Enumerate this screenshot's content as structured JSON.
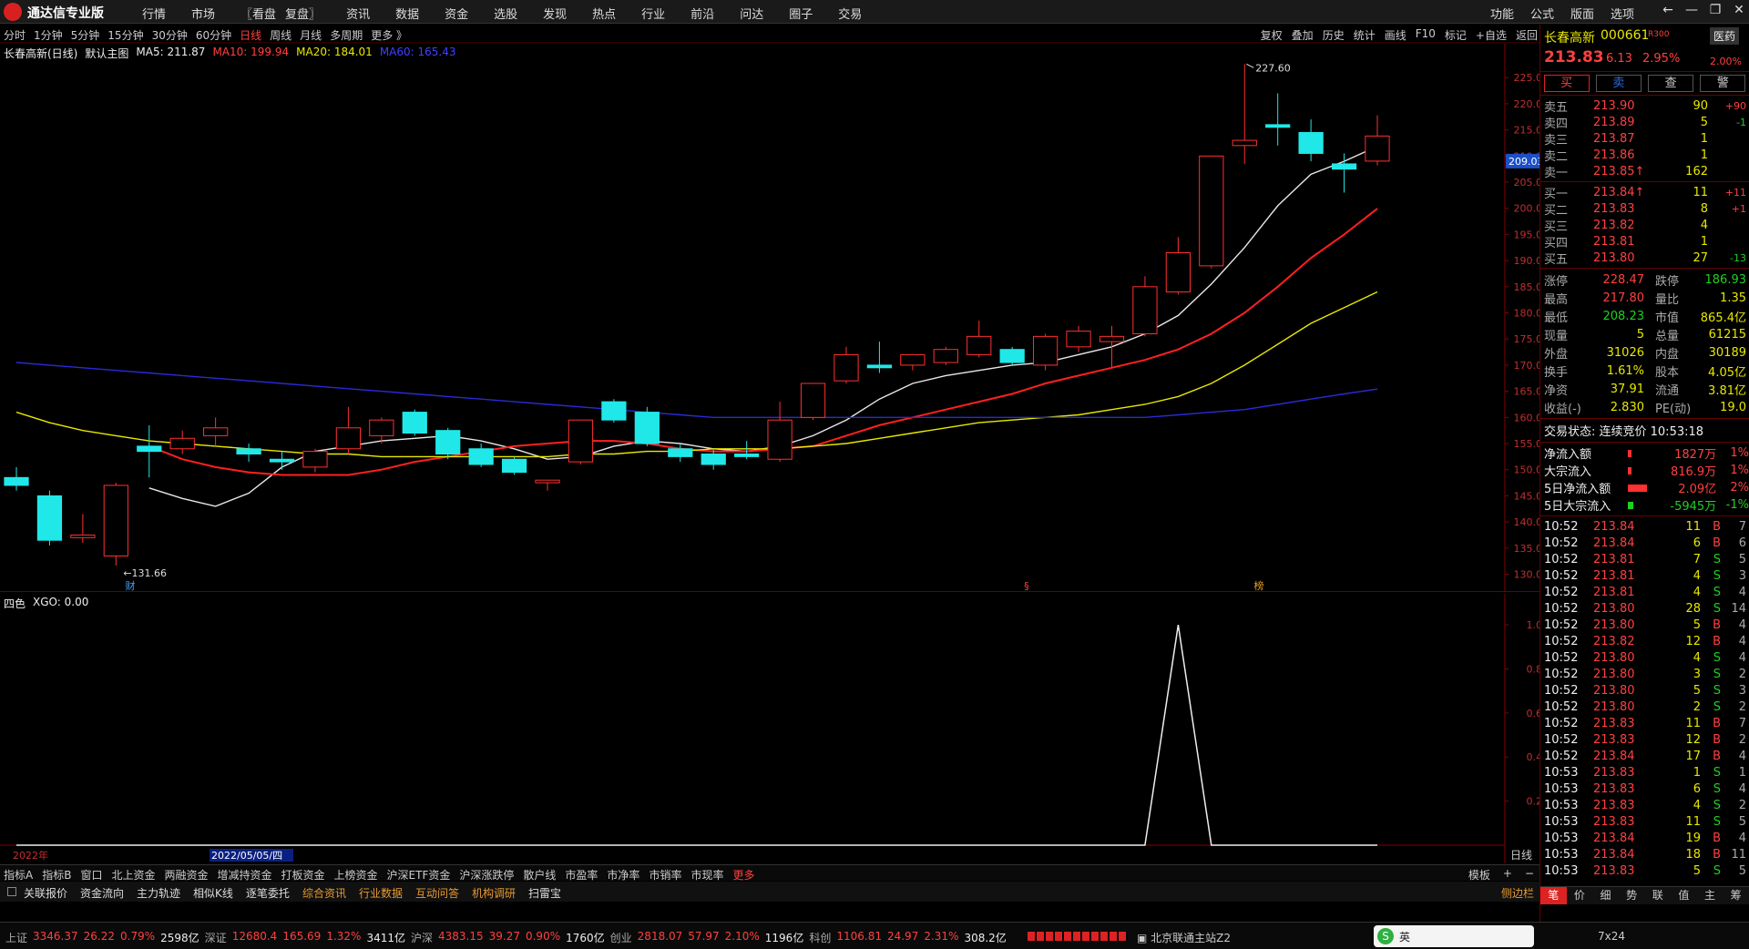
{
  "app": {
    "title": "通达信专业版",
    "menu": [
      "行情",
      "市场",
      "〖看盘",
      "复盘〗",
      "资讯",
      "数据",
      "资金",
      "选股",
      "发现",
      "热点",
      "行业",
      "前沿",
      "问达",
      "圈子",
      "交易"
    ],
    "right_menu": [
      "功能",
      "公式",
      "版面",
      "选项"
    ]
  },
  "period_bar": {
    "items": [
      "分时",
      "1分钟",
      "5分钟",
      "15分钟",
      "30分钟",
      "60分钟",
      "日线",
      "周线",
      "月线",
      "多周期",
      "更多 》"
    ],
    "active": "日线",
    "tools": [
      "复权",
      "叠加",
      "历史",
      "统计",
      "画线",
      "F10",
      "标记",
      "+自选",
      "返回"
    ]
  },
  "legend": {
    "name": "长春高新(日线)",
    "template": "默认主图",
    "ma5": "MA5: 211.87",
    "ma10": "MA10: 199.94",
    "ma20": "MA20: 184.01",
    "ma60": "MA60: 165.43"
  },
  "indicator": {
    "name": "四色",
    "value": "XGO: 0.00"
  },
  "chart_data": [
    {
      "type": "candlestick",
      "title": "长春高新(日线)",
      "ylim": [
        128,
        228
      ],
      "y_ticks": [
        130,
        135,
        140,
        145,
        150,
        155,
        160,
        165,
        170,
        175,
        180,
        185,
        190,
        195,
        200,
        205,
        210,
        215,
        220,
        225
      ],
      "y_tick_labels": [
        "130.00",
        "135.00",
        "140.00",
        "145.00",
        "150.00",
        "155.00",
        "160.00",
        "165.00",
        "170.00",
        "175.00",
        "180.00",
        "185.00",
        "190.00",
        "195.00",
        "200.00",
        "205.00",
        "210.00",
        "215.00",
        "220.00",
        "225.00"
      ],
      "current_price_label": "209.03",
      "current_price": 209.03,
      "high_label": "227.60",
      "high_value": 227.6,
      "low_label": "←131.66",
      "low_value": 131.66,
      "x_labels": [
        "2022年",
        "2022/05/05/四"
      ],
      "markers": [
        "财",
        "§",
        "榜"
      ],
      "candles": [
        {
          "o": 148.5,
          "h": 150.5,
          "c": 147.0,
          "l": 146.0
        },
        {
          "o": 145.0,
          "h": 146.0,
          "c": 136.5,
          "l": 135.5
        },
        {
          "o": 137.0,
          "h": 141.5,
          "c": 137.5,
          "l": 136.0
        },
        {
          "o": 133.5,
          "h": 147.5,
          "c": 147.0,
          "l": 131.66
        },
        {
          "o": 154.5,
          "h": 158.5,
          "c": 153.5,
          "l": 148.5
        },
        {
          "o": 154.0,
          "h": 157.5,
          "c": 156.0,
          "l": 153.0
        },
        {
          "o": 156.5,
          "h": 160.0,
          "c": 158.0,
          "l": 154.5
        },
        {
          "o": 154.0,
          "h": 155.0,
          "c": 153.0,
          "l": 151.5
        },
        {
          "o": 152.0,
          "h": 153.5,
          "c": 151.5,
          "l": 150.0
        },
        {
          "o": 150.5,
          "h": 154.0,
          "c": 153.5,
          "l": 149.5
        },
        {
          "o": 154.0,
          "h": 162.0,
          "c": 158.0,
          "l": 153.0
        },
        {
          "o": 156.5,
          "h": 160.0,
          "c": 159.5,
          "l": 155.0
        },
        {
          "o": 161.0,
          "h": 161.5,
          "c": 157.0,
          "l": 156.5
        },
        {
          "o": 157.5,
          "h": 158.0,
          "c": 153.0,
          "l": 152.0
        },
        {
          "o": 154.0,
          "h": 155.0,
          "c": 151.0,
          "l": 150.5
        },
        {
          "o": 152.0,
          "h": 152.5,
          "c": 149.5,
          "l": 149.0
        },
        {
          "o": 147.5,
          "h": 148.0,
          "c": 148.0,
          "l": 146.0
        },
        {
          "o": 151.5,
          "h": 159.5,
          "c": 159.5,
          "l": 151.0
        },
        {
          "o": 163.0,
          "h": 163.5,
          "c": 159.5,
          "l": 159.0
        },
        {
          "o": 161.0,
          "h": 162.0,
          "c": 155.0,
          "l": 154.5
        },
        {
          "o": 154.0,
          "h": 155.0,
          "c": 152.5,
          "l": 151.5
        },
        {
          "o": 153.0,
          "h": 154.0,
          "c": 151.0,
          "l": 150.0
        },
        {
          "o": 153.0,
          "h": 155.5,
          "c": 152.5,
          "l": 152.0
        },
        {
          "o": 152.0,
          "h": 163.0,
          "c": 159.5,
          "l": 151.5
        },
        {
          "o": 160.0,
          "h": 166.5,
          "c": 166.5,
          "l": 159.5
        },
        {
          "o": 167.0,
          "h": 173.5,
          "c": 172.0,
          "l": 166.5
        },
        {
          "o": 170.0,
          "h": 174.5,
          "c": 169.5,
          "l": 168.5
        },
        {
          "o": 170.0,
          "h": 172.0,
          "c": 172.0,
          "l": 169.0
        },
        {
          "o": 170.5,
          "h": 173.5,
          "c": 173.0,
          "l": 170.0
        },
        {
          "o": 172.0,
          "h": 178.5,
          "c": 175.5,
          "l": 171.5
        },
        {
          "o": 173.0,
          "h": 173.5,
          "c": 170.5,
          "l": 170.0
        },
        {
          "o": 170.0,
          "h": 176.0,
          "c": 175.5,
          "l": 169.0
        },
        {
          "o": 173.5,
          "h": 177.5,
          "c": 176.5,
          "l": 172.5
        },
        {
          "o": 174.5,
          "h": 177.5,
          "c": 175.5,
          "l": 169.5
        },
        {
          "o": 176.0,
          "h": 187.0,
          "c": 185.0,
          "l": 175.5
        },
        {
          "o": 184.0,
          "h": 194.5,
          "c": 191.5,
          "l": 183.5
        },
        {
          "o": 189.0,
          "h": 210.0,
          "c": 210.0,
          "l": 188.5
        },
        {
          "o": 212.0,
          "h": 227.6,
          "c": 213.0,
          "l": 208.5
        },
        {
          "o": 216.0,
          "h": 222.0,
          "c": 215.5,
          "l": 212.0
        },
        {
          "o": 214.5,
          "h": 217.0,
          "c": 210.5,
          "l": 209.0
        },
        {
          "o": 208.5,
          "h": 210.5,
          "c": 207.5,
          "l": 203.0
        },
        {
          "o": 209.03,
          "h": 217.8,
          "c": 213.83,
          "l": 208.23
        }
      ],
      "ma_series": [
        {
          "name": "MA5",
          "color": "#e8e8e8",
          "values": [
            null,
            null,
            null,
            null,
            146.5,
            144.5,
            143.0,
            145.5,
            150.5,
            153.5,
            154.5,
            155.5,
            156.0,
            156.5,
            155.5,
            154.0,
            152.0,
            152.5,
            154.5,
            155.5,
            155.0,
            154.0,
            153.5,
            154.5,
            156.5,
            159.5,
            163.5,
            166.5,
            168.0,
            169.0,
            170.0,
            170.5,
            172.0,
            173.5,
            176.0,
            179.5,
            185.5,
            192.5,
            200.5,
            206.5,
            209.0,
            211.87
          ]
        },
        {
          "name": "MA10",
          "color": "#ff2020",
          "values": [
            null,
            null,
            null,
            null,
            154.5,
            152.0,
            150.5,
            149.5,
            149.0,
            149.0,
            149.0,
            150.0,
            151.5,
            152.5,
            153.5,
            154.5,
            155.0,
            155.5,
            155.5,
            155.0,
            154.0,
            153.5,
            153.5,
            154.0,
            154.5,
            156.5,
            158.5,
            160.0,
            161.5,
            163.0,
            164.5,
            166.5,
            168.0,
            169.5,
            171.0,
            173.0,
            176.0,
            180.0,
            185.0,
            190.5,
            195.0,
            199.94
          ]
        },
        {
          "name": "MA20",
          "color": "#e8e800",
          "values": [
            161.0,
            159.0,
            157.5,
            156.5,
            155.5,
            155.0,
            154.5,
            154.0,
            153.5,
            153.0,
            153.0,
            152.5,
            152.5,
            152.5,
            152.5,
            152.5,
            152.5,
            153.0,
            153.0,
            153.5,
            153.5,
            154.0,
            154.0,
            154.0,
            154.5,
            155.0,
            156.0,
            157.0,
            158.0,
            159.0,
            159.5,
            160.0,
            160.5,
            161.5,
            162.5,
            164.0,
            166.5,
            170.0,
            174.0,
            178.0,
            181.0,
            184.01
          ]
        },
        {
          "name": "MA60",
          "color": "#2a2ad8",
          "values": [
            170.5,
            170.0,
            169.5,
            169.0,
            168.5,
            168.0,
            167.5,
            167.0,
            166.5,
            166.0,
            165.5,
            165.0,
            164.5,
            164.0,
            163.5,
            163.0,
            162.5,
            162.0,
            161.5,
            161.0,
            160.5,
            160.0,
            160.0,
            160.0,
            160.0,
            160.0,
            160.0,
            160.0,
            160.0,
            160.0,
            160.0,
            160.0,
            160.0,
            160.0,
            160.0,
            160.5,
            161.0,
            161.5,
            162.5,
            163.5,
            164.5,
            165.43
          ]
        }
      ]
    },
    {
      "type": "line",
      "title": "四色",
      "ylim": [
        0,
        1.05
      ],
      "y_ticks": [
        0.2,
        0.4,
        0.6,
        0.8,
        1.0
      ],
      "y_tick_labels": [
        "0.20",
        "0.40",
        "0.60",
        "0.80",
        "1.00"
      ],
      "x_axis_label": "日线",
      "values": [
        0,
        0,
        0,
        0,
        0,
        0,
        0,
        0,
        0,
        0,
        0,
        0,
        0,
        0,
        0,
        0,
        0,
        0,
        0,
        0,
        0,
        0,
        0,
        0,
        0,
        0,
        0,
        0,
        0,
        0,
        0,
        0,
        0,
        0,
        0,
        1,
        0,
        0,
        0,
        0,
        0,
        0
      ]
    }
  ],
  "quote": {
    "name": "长春高新",
    "code": "000661",
    "tag": "R300",
    "sector": "医药",
    "price": "213.83",
    "change": "6.13",
    "pct": "2.95%",
    "sector_pct": "2.00%",
    "buttons": [
      "买",
      "卖",
      "查",
      "警"
    ],
    "asks": [
      {
        "label": "卖五",
        "price": "213.90",
        "vol": "90",
        "chg": "+90"
      },
      {
        "label": "卖四",
        "price": "213.89",
        "vol": "5",
        "chg": "-1"
      },
      {
        "label": "卖三",
        "price": "213.87",
        "vol": "1",
        "chg": ""
      },
      {
        "label": "卖二",
        "price": "213.86",
        "vol": "1",
        "chg": ""
      },
      {
        "label": "卖一",
        "price": "213.85↑",
        "vol": "162",
        "chg": ""
      }
    ],
    "bids": [
      {
        "label": "买一",
        "price": "213.84↑",
        "vol": "11",
        "chg": "+11"
      },
      {
        "label": "买二",
        "price": "213.83",
        "vol": "8",
        "chg": "+1"
      },
      {
        "label": "买三",
        "price": "213.82",
        "vol": "4",
        "chg": ""
      },
      {
        "label": "买四",
        "price": "213.81",
        "vol": "1",
        "chg": ""
      },
      {
        "label": "买五",
        "price": "213.80",
        "vol": "27",
        "chg": "-13"
      }
    ],
    "stats": [
      [
        "涨停",
        "228.47",
        "跌停",
        "186.93"
      ],
      [
        "最高",
        "217.80",
        "量比",
        "1.35"
      ],
      [
        "最低",
        "208.23",
        "市值",
        "865.4亿"
      ],
      [
        "现量",
        "5",
        "总量",
        "61215"
      ],
      [
        "外盘",
        "31026",
        "内盘",
        "30189"
      ],
      [
        "换手",
        "1.61%",
        "股本",
        "4.05亿"
      ],
      [
        "净资",
        "37.91",
        "流通",
        "3.81亿"
      ],
      [
        "收益(-)",
        "2.830",
        "PE(动)",
        "19.0"
      ]
    ],
    "trade_status": "交易状态: 连续竞价 10:53:18",
    "flows": [
      {
        "label": "净流入额",
        "value": "1827万",
        "pct": "1%"
      },
      {
        "label": "大宗流入",
        "value": "816.9万",
        "pct": "1%"
      },
      {
        "label": "5日净流入额",
        "value": "2.09亿",
        "pct": "2%"
      },
      {
        "label": "5日大宗流入",
        "value": "-5945万",
        "pct": "-1%"
      }
    ],
    "ticks": [
      [
        "10:52",
        "213.84",
        "11",
        "B",
        "7"
      ],
      [
        "10:52",
        "213.84",
        "6",
        "B",
        "6"
      ],
      [
        "10:52",
        "213.81",
        "7",
        "S",
        "5"
      ],
      [
        "10:52",
        "213.81",
        "4",
        "S",
        "3"
      ],
      [
        "10:52",
        "213.81",
        "4",
        "S",
        "4"
      ],
      [
        "10:52",
        "213.80",
        "28",
        "S",
        "14"
      ],
      [
        "10:52",
        "213.80",
        "5",
        "B",
        "4"
      ],
      [
        "10:52",
        "213.82",
        "12",
        "B",
        "4"
      ],
      [
        "10:52",
        "213.80",
        "4",
        "S",
        "4"
      ],
      [
        "10:52",
        "213.80",
        "3",
        "S",
        "2"
      ],
      [
        "10:52",
        "213.80",
        "5",
        "S",
        "3"
      ],
      [
        "10:52",
        "213.80",
        "2",
        "S",
        "2"
      ],
      [
        "10:52",
        "213.83",
        "11",
        "B",
        "7"
      ],
      [
        "10:52",
        "213.83",
        "12",
        "B",
        "2"
      ],
      [
        "10:52",
        "213.84",
        "17",
        "B",
        "4"
      ],
      [
        "10:53",
        "213.83",
        "1",
        "S",
        "1"
      ],
      [
        "10:53",
        "213.83",
        "6",
        "S",
        "4"
      ],
      [
        "10:53",
        "213.83",
        "4",
        "S",
        "2"
      ],
      [
        "10:53",
        "213.83",
        "11",
        "S",
        "5"
      ],
      [
        "10:53",
        "213.84",
        "19",
        "B",
        "4"
      ],
      [
        "10:53",
        "213.84",
        "18",
        "B",
        "11"
      ],
      [
        "10:53",
        "213.83",
        "5",
        "S",
        "5"
      ]
    ],
    "bottom_tabs": [
      "笔",
      "价",
      "细",
      "势",
      "联",
      "值",
      "主",
      "筹"
    ]
  },
  "bottom_bar1": {
    "items": [
      "指标A",
      "指标B",
      "窗口",
      "北上资金",
      "两融资金",
      "增减持资金",
      "打板资金",
      "上榜资金",
      "沪深ETF资金",
      "沪深涨跌停",
      "散户线",
      "市盈率",
      "市净率",
      "市销率",
      "市现率",
      "更多"
    ],
    "right": [
      "模板",
      "+",
      "−"
    ]
  },
  "bottom_bar2": {
    "items": [
      "关联报价",
      "资金流向",
      "主力轨迹",
      "相似K线",
      "逐笔委托",
      "综合资讯",
      "行业数据",
      "互动问答",
      "机构调研",
      "扫雷宝"
    ],
    "right": "侧边栏"
  },
  "statusbar": {
    "items": [
      {
        "text": "上证",
        "c": "grey"
      },
      {
        "text": "3346.37",
        "c": "red"
      },
      {
        "text": "26.22",
        "c": "red"
      },
      {
        "text": "0.79%",
        "c": "red"
      },
      {
        "text": "2598亿",
        "c": "white"
      },
      {
        "text": "深证",
        "c": "grey"
      },
      {
        "text": "12680.4",
        "c": "red"
      },
      {
        "text": "165.69",
        "c": "red"
      },
      {
        "text": "1.32%",
        "c": "red"
      },
      {
        "text": "3411亿",
        "c": "white"
      },
      {
        "text": "沪深",
        "c": "grey"
      },
      {
        "text": "4383.15",
        "c": "red"
      },
      {
        "text": "39.27",
        "c": "red"
      },
      {
        "text": "0.90%",
        "c": "red"
      },
      {
        "text": "1760亿",
        "c": "white"
      },
      {
        "text": "创业",
        "c": "grey"
      },
      {
        "text": "2818.07",
        "c": "red"
      },
      {
        "text": "57.97",
        "c": "red"
      },
      {
        "text": "2.10%",
        "c": "red"
      },
      {
        "text": "1196亿",
        "c": "white"
      },
      {
        "text": "科创",
        "c": "grey"
      },
      {
        "text": "1106.81",
        "c": "red"
      },
      {
        "text": "24.97",
        "c": "red"
      },
      {
        "text": "2.31%",
        "c": "red"
      },
      {
        "text": "308.2亿",
        "c": "white"
      }
    ],
    "server": "北京联通主站Z2",
    "ime": "英",
    "grid": "7x24"
  }
}
